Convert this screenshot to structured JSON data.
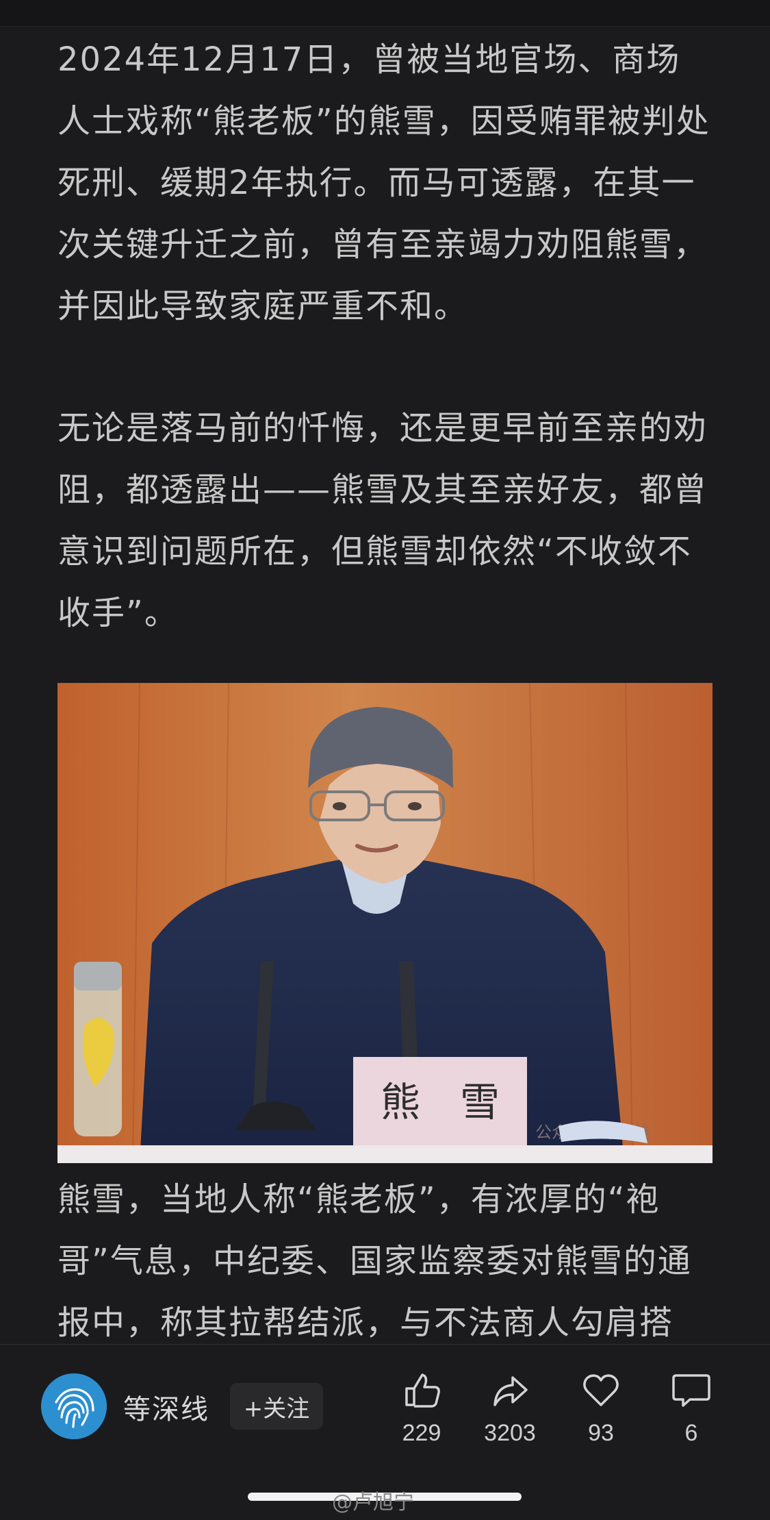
{
  "article": {
    "paragraph_1": "2024年12月17日，曾被当地官场、商场人士戏称“熊老板”的熊雪，因受贿罪被判处死刑、缓期2年执行。而马可透露，在其一次关键升迁之前，曾有至亲竭力劝阻熊雪，并因此导致家庭严重不和。",
    "paragraph_2": "无论是落马前的忏悔，还是更早前至亲的劝阻，都透露出——熊雪及其至亲好友，都曾意识到问题所在，但熊雪却依然“不收敛不收手”。",
    "caption": "熊雪，当地人称“熊老板”，有浓厚的“袍哥”气息，中纪委、国家监察委对熊雪的通报中，称其拉帮结派，与不法商人勾肩搭"
  },
  "photo": {
    "nameplate": "熊　雪",
    "overlay_watermark": "公众号 · 等深线"
  },
  "author": {
    "name": "等深线",
    "follow_label": "+关注",
    "icon": "fingerprint-icon"
  },
  "actions": {
    "like_count": "229",
    "share_count": "3203",
    "favorite_count": "93",
    "comment_count": "6"
  },
  "watermark": "@卢旭宁",
  "colors": {
    "background": "#1b1b1d",
    "text": "#c8c8c8",
    "avatar": "#2c8fd0"
  }
}
